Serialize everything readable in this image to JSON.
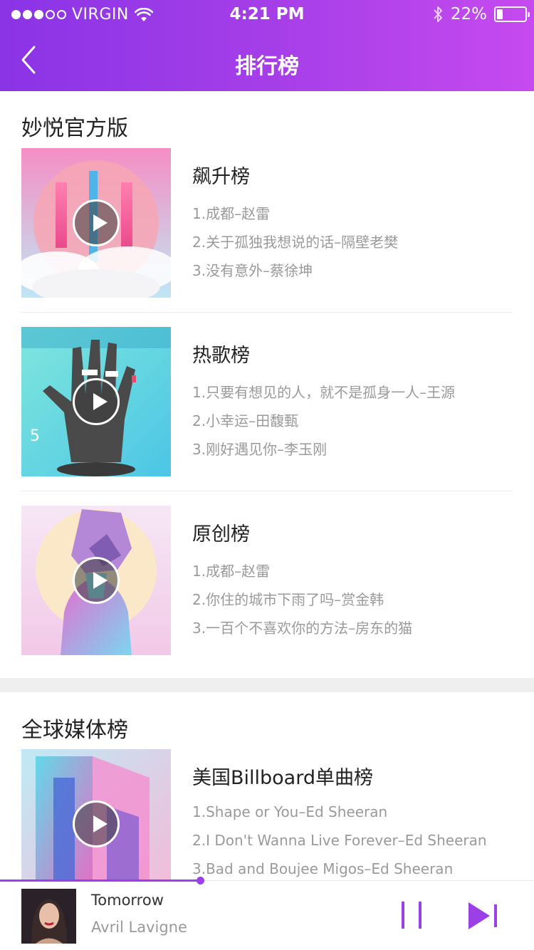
{
  "status_bar": {
    "carrier": "VIRGIN",
    "time": "4:21 PM",
    "battery": "22%",
    "battery_level": 0.22,
    "signal_bars_filled": 3,
    "signal_bars_total": 5
  },
  "nav": {
    "title": "排行榜",
    "back_icon": "chevron-left-icon"
  },
  "sections": [
    {
      "title": "妙悦官方版",
      "charts": [
        {
          "title": "飙升榜",
          "tracks": [
            "1.成都–赵雷",
            "2.关于孤独我想说的话–隔壁老樊",
            "3.没有意外–蔡徐坤"
          ]
        },
        {
          "title": "热歌榜",
          "tracks": [
            "1.只要有想见的人，就不是孤身一人–王源",
            "2.小幸运–田馥甄",
            "3.刚好遇见你–李玉刚"
          ]
        },
        {
          "title": "原创榜",
          "tracks": [
            "1.成都–赵雷",
            "2.你住的城市下雨了吗–赏金韩",
            "3.一百个不喜欢你的方法–房东的猫"
          ]
        }
      ]
    },
    {
      "title": "全球媒体榜",
      "charts": [
        {
          "title": "美国Billboard单曲榜",
          "tracks": [
            "1.Shape or You–Ed Sheeran",
            "2.I Don't Wanna Live Forever–Ed Sheeran",
            "3.Bad and Boujee Migos–Ed Sheeran"
          ]
        }
      ]
    }
  ],
  "player": {
    "song": "Tomorrow",
    "artist": "Avril Lavigne",
    "progress": 0.375,
    "pause_icon": "pause-icon",
    "next_icon": "skip-next-icon"
  },
  "colors": {
    "header_start": "#8a34e6",
    "header_end": "#c64aef",
    "accent": "#9b3fe6"
  }
}
